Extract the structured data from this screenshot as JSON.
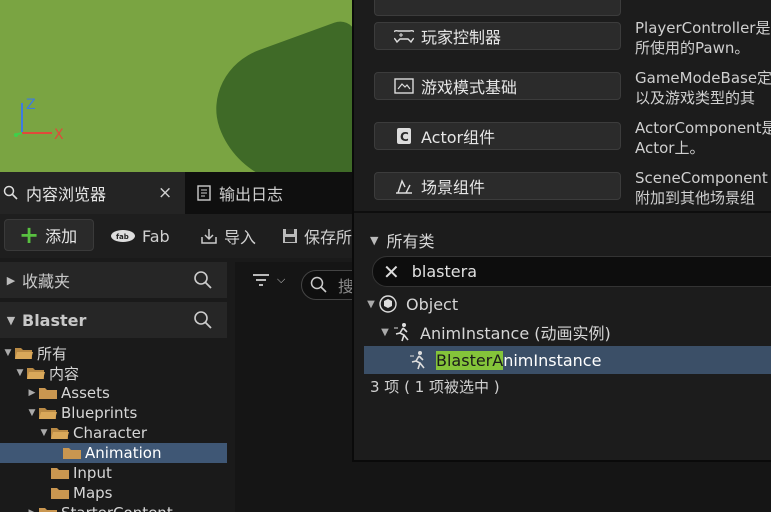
{
  "viewport": {
    "axes": {
      "z": "Z",
      "x": "X"
    }
  },
  "content_browser": {
    "tabs": [
      {
        "label": "内容浏览器",
        "close": "×"
      },
      {
        "label": "输出日志"
      }
    ],
    "toolbar": {
      "add": "添加",
      "fab": "Fab",
      "import": "导入",
      "save": "保存所"
    },
    "favorites_label": "收藏夹",
    "project_label": "Blaster",
    "tree": [
      {
        "label": "所有",
        "depth": 0,
        "expanded": true
      },
      {
        "label": "内容",
        "depth": 1,
        "expanded": true
      },
      {
        "label": "Assets",
        "depth": 2,
        "expanded": false
      },
      {
        "label": "Blueprints",
        "depth": 2,
        "expanded": true
      },
      {
        "label": "Character",
        "depth": 3,
        "expanded": true
      },
      {
        "label": "Animation",
        "depth": 4,
        "selected": true
      },
      {
        "label": "Input",
        "depth": 3
      },
      {
        "label": "Maps",
        "depth": 3
      },
      {
        "label": "StarterContent",
        "depth": 2,
        "expanded": false
      }
    ],
    "search_placeholder": "搜"
  },
  "class_picker": {
    "common_classes": [
      {
        "label": "玩家控制器",
        "icon": "gamepad-icon",
        "desc1": "PlayerController是",
        "desc2": "所使用的Pawn。"
      },
      {
        "label": "游戏模式基础",
        "icon": "gamemode-icon",
        "desc1": "GameModeBase定",
        "desc2": "以及游戏类型的其"
      },
      {
        "label": "Actor组件",
        "icon": "actor-component-icon",
        "desc1": "ActorComponent是",
        "desc2": "Actor上。"
      },
      {
        "label": "场景组件",
        "icon": "scene-component-icon",
        "desc1": "SceneComponent",
        "desc2": "附加到其他场景组"
      }
    ],
    "all_classes_label": "所有类",
    "search_value": "blastera",
    "tree": [
      {
        "label": "Object",
        "depth": 0
      },
      {
        "label": "AnimInstance (动画实例)",
        "depth": 1
      },
      {
        "highlight": "BlasterA",
        "rest": "nimInstance",
        "depth": 2,
        "selected": true
      }
    ],
    "status": "3 项 ( 1 项被选中 )"
  }
}
